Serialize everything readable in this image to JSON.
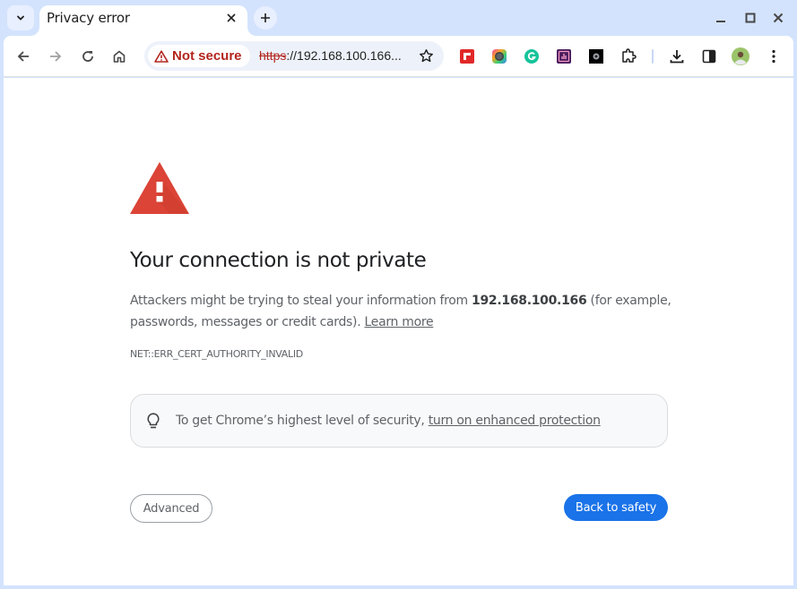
{
  "tabstrip": {
    "tab_search_icon": "chevron-down-icon",
    "tab": {
      "title": "Privacy error",
      "close_icon": "close-icon"
    },
    "new_tab_icon": "plus-icon",
    "window_controls": [
      "minimize-icon",
      "maximize-icon",
      "close-icon"
    ]
  },
  "toolbar": {
    "nav": [
      "back-arrow-icon",
      "forward-arrow-icon",
      "reload-icon",
      "home-icon"
    ],
    "security_chip": {
      "icon": "warning-triangle-icon",
      "label": "Not secure",
      "color": "#b3261e"
    },
    "url": {
      "scheme": "https",
      "rest": "://192.168.100.166..."
    },
    "bookmark_icon": "star-icon",
    "extensions": [
      "flipboard-extension-icon",
      "color-picker-extension-icon",
      "grammarly-extension-icon",
      "analytics-extension-icon",
      "dark-extension-icon",
      "extensions-puzzle-icon"
    ],
    "right": [
      "download-icon",
      "side-panel-icon",
      "profile-avatar",
      "more-menu-icon"
    ]
  },
  "page": {
    "warning_icon": "warning-triangle-icon",
    "heading": "Your connection is not private",
    "explanation": {
      "before": "Attackers might be trying to steal your information from ",
      "host": "192.168.100.166",
      "after": " (for example, passwords, messages or credit cards). ",
      "learn_more": "Learn more"
    },
    "error_code": "NET::ERR_CERT_AUTHORITY_INVALID",
    "enhanced": {
      "icon": "lightbulb-icon",
      "text": "To get Chrome’s highest level of security, ",
      "link": "turn on enhanced protection"
    },
    "buttons": {
      "advanced": "Advanced",
      "back_to_safety": "Back to safety"
    },
    "colors": {
      "accent": "#1a73e8",
      "warning": "#db4437",
      "frame": "#d3e3fd"
    }
  }
}
